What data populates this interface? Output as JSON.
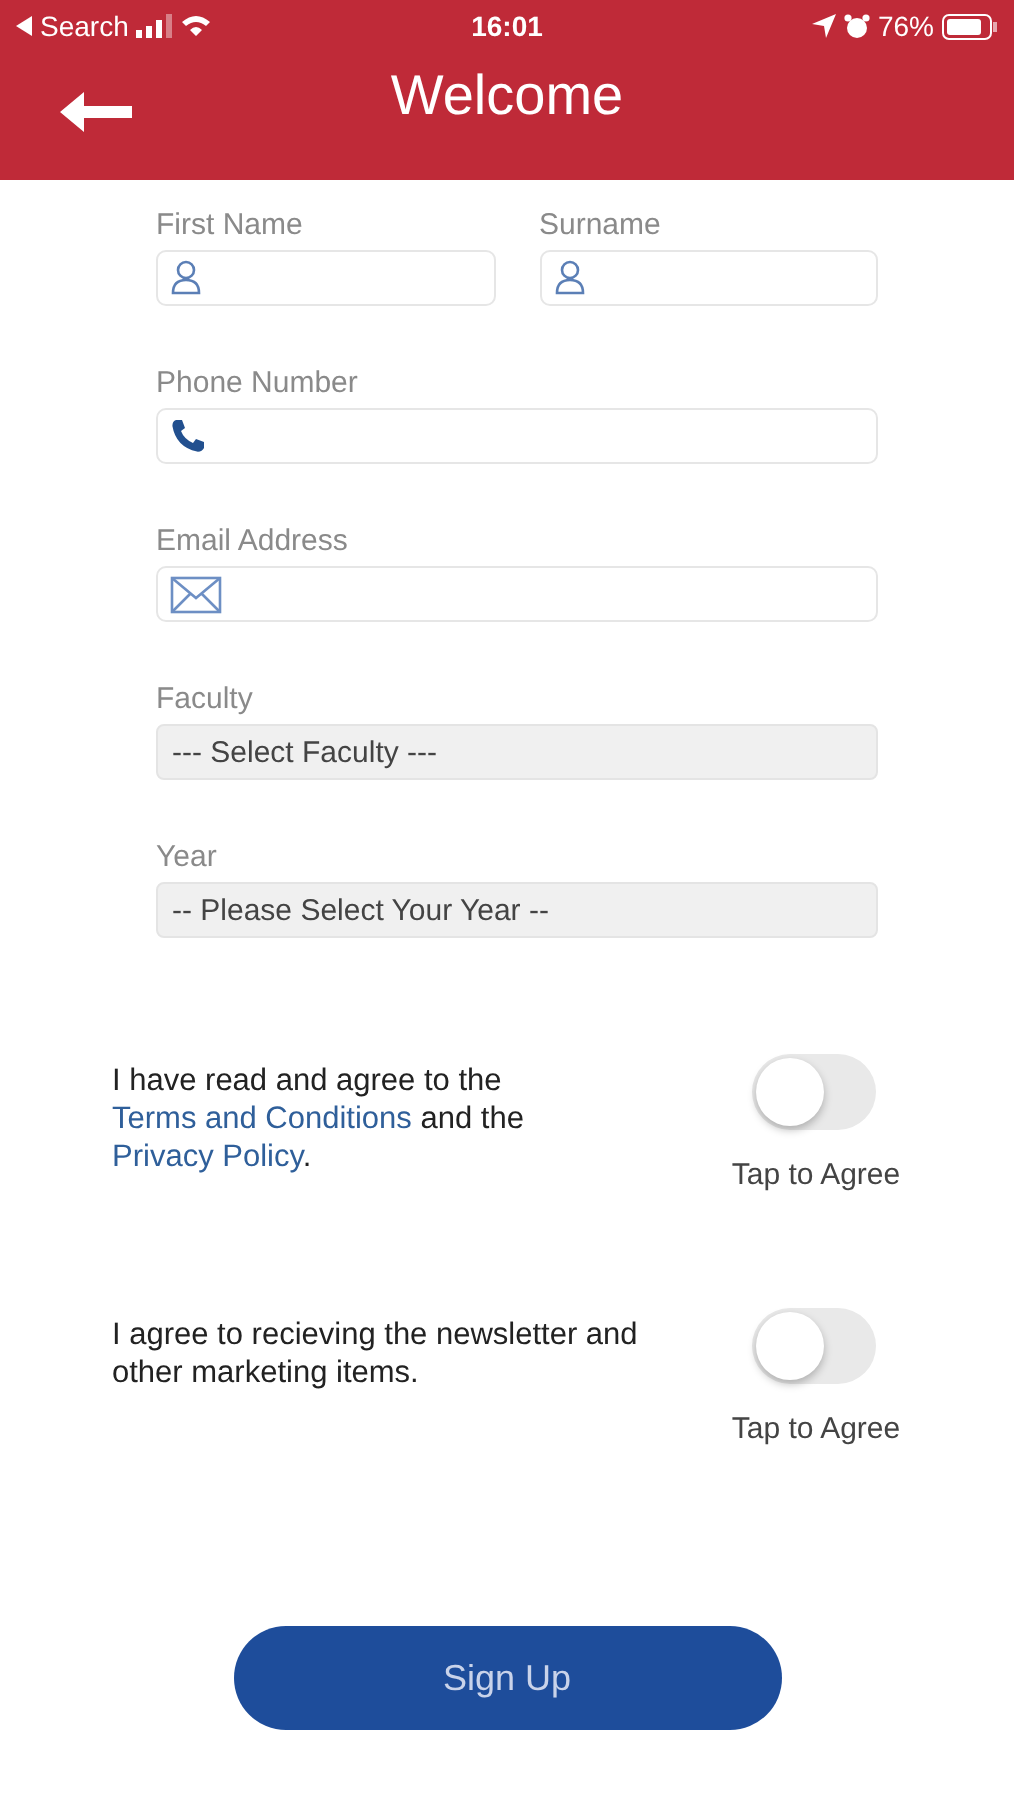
{
  "status_bar": {
    "back_label": "Search",
    "time": "16:01",
    "battery": "76%"
  },
  "header": {
    "title": "Welcome"
  },
  "form_rows": [
    [
      {
        "label": "First Name",
        "kind": "name"
      },
      {
        "label": "Surname",
        "kind": "name"
      }
    ],
    [
      {
        "label": "Phone Number",
        "kind": "phone"
      }
    ],
    [
      {
        "label": "Email Address",
        "kind": "email"
      }
    ],
    [
      {
        "label": "Faculty",
        "kind": "select",
        "value": "--- Select Faculty ---"
      }
    ],
    [
      {
        "label": "Year",
        "kind": "select",
        "value": "-- Please Select Your Year --"
      }
    ]
  ],
  "agreements": [
    {
      "parts": [
        {
          "kind": "plain",
          "text": "I have read and agree to the "
        },
        {
          "kind": "link",
          "text": "Terms and Conditions"
        },
        {
          "kind": "plain",
          "text": " and the "
        },
        {
          "kind": "link",
          "text": "Privacy Policy"
        },
        {
          "kind": "plain",
          "text": "."
        }
      ],
      "on": false,
      "toggle_label": "Tap to Agree"
    },
    {
      "parts": [
        {
          "kind": "plain",
          "text": "I agree to recieving the newsletter and other marketing items."
        }
      ],
      "on": false,
      "toggle_label": "Tap to Agree"
    }
  ],
  "submit": {
    "label": "Sign Up"
  }
}
